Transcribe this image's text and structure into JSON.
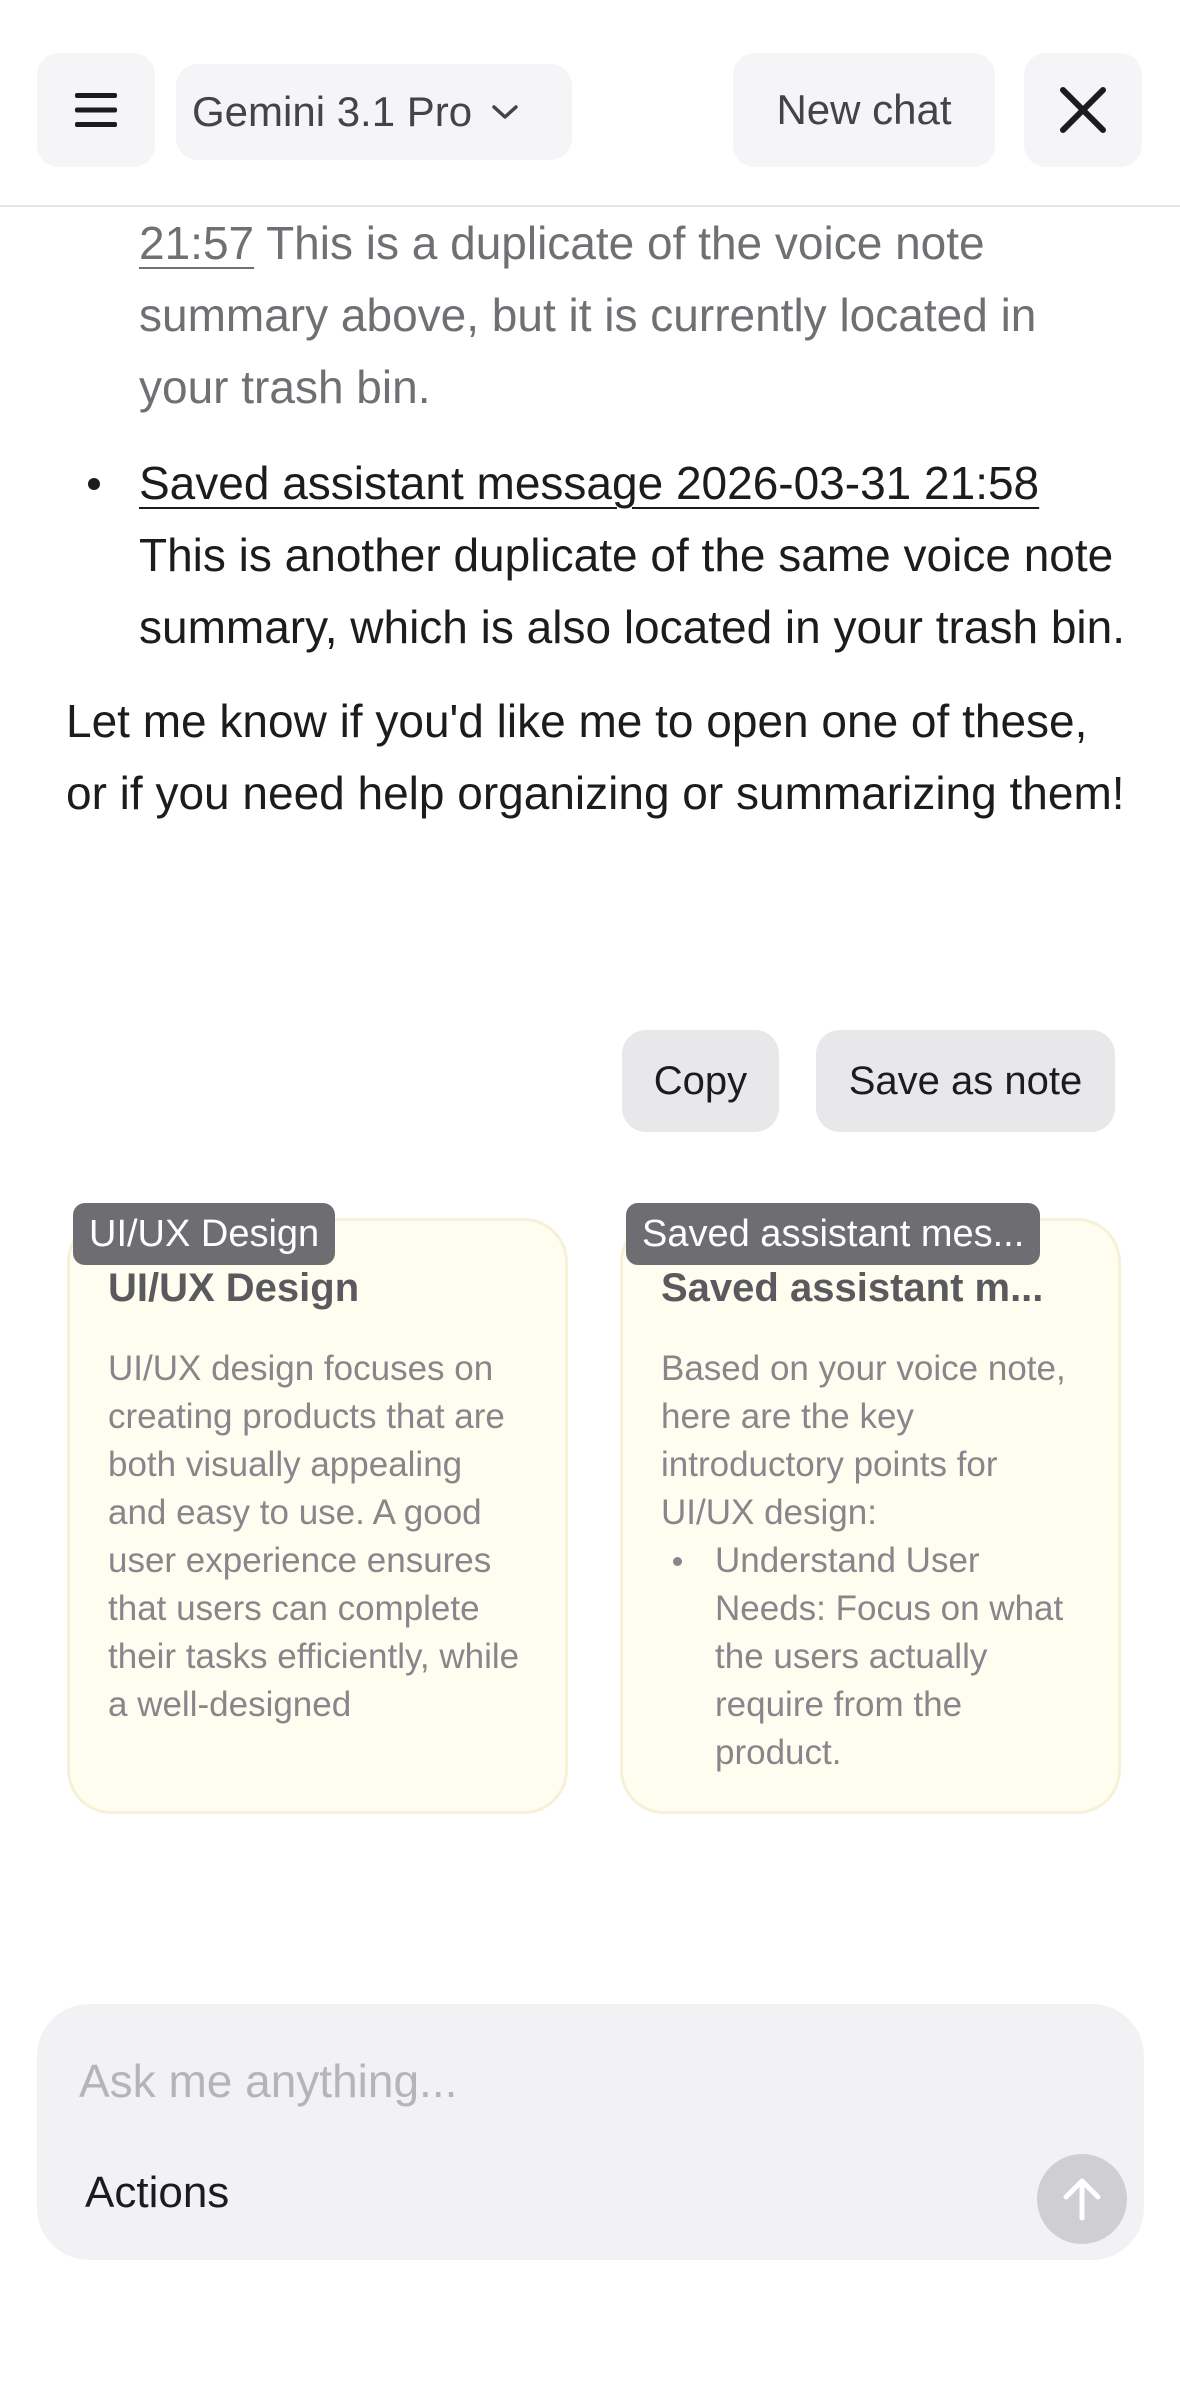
{
  "header": {
    "menu_icon": "hamburger-menu-icon",
    "model_name": "Gemini 3.1 Pro",
    "model_chevron_icon": "chevron-down-icon",
    "new_chat_label": "New chat",
    "close_icon": "close-icon"
  },
  "message": {
    "items": [
      {
        "link": "21:57",
        "text": " This is a duplicate of the voice note summary above, but it is currently located in your trash bin."
      },
      {
        "link": "Saved assistant message 2026-03-31 21:58",
        "text": " This is another duplicate of the same voice note summary, which is also located in your trash bin."
      }
    ],
    "closing": "Let me know if you'd like me to open one of these, or if you need help organizing or sum­marizing them!"
  },
  "actions": {
    "copy_label": "Copy",
    "save_label": "Save as note"
  },
  "cards": [
    {
      "tag": "UI/UX Design",
      "title": "UI/UX Design",
      "body": "UI/UX design focuses on creating products that are both visually appealing and easy to use. A good user experience ensures that users can complete their tasks efficiently, while a well-designed"
    },
    {
      "tag": "Saved assistant mes...",
      "title": "Saved assistant m...",
      "intro": "Based on your voice note, here are the key introductory points for UI/UX design:",
      "bullets": [
        "Understand User Needs: Focus on what the users actually require from the product."
      ]
    }
  ],
  "composer": {
    "placeholder": "Ask me anything...",
    "actions_label": "Actions",
    "send_icon": "arrow-up-icon"
  },
  "colors": {
    "card_background": "#fffdf0",
    "tag_background": "#6e6e72",
    "button_background": "#e8e8eb",
    "composer_background": "#f2f2f5"
  }
}
